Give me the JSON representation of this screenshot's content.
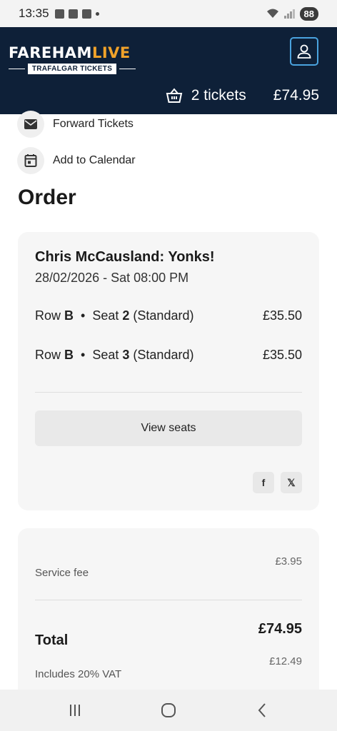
{
  "status_bar": {
    "time": "13:35",
    "battery": "88"
  },
  "header": {
    "logo_main": "FAREHAM",
    "logo_live": "LIVE",
    "logo_sub": "TRAFALGAR TICKETS",
    "basket_count": "2 tickets",
    "basket_total": "£74.95"
  },
  "actions": [
    {
      "label": "Forward Tickets",
      "icon": "mail-icon"
    },
    {
      "label": "Add to Calendar",
      "icon": "calendar-icon"
    }
  ],
  "order": {
    "heading": "Order",
    "event_title": "Chris McCausland: Yonks!",
    "event_date": "28/02/2026 - Sat 08:00 PM",
    "tickets": [
      {
        "row_label": "Row",
        "row": "B",
        "seat_label": "Seat",
        "seat": "2",
        "type": "(Standard)",
        "price": "£35.50"
      },
      {
        "row_label": "Row",
        "row": "B",
        "seat_label": "Seat",
        "seat": "3",
        "type": "(Standard)",
        "price": "£35.50"
      }
    ],
    "view_seats_label": "View seats",
    "share": {
      "facebook": "f",
      "x": "𝕏"
    }
  },
  "summary": {
    "service_fee_label": "Service fee",
    "service_fee_value": "£3.95",
    "total_label": "Total",
    "total_value": "£74.95",
    "vat_label": "Includes 20% VAT",
    "vat_value": "£12.49"
  },
  "colors": {
    "header_bg": "#0e2038",
    "accent": "#f0a22a",
    "account_border": "#4aa3df"
  }
}
